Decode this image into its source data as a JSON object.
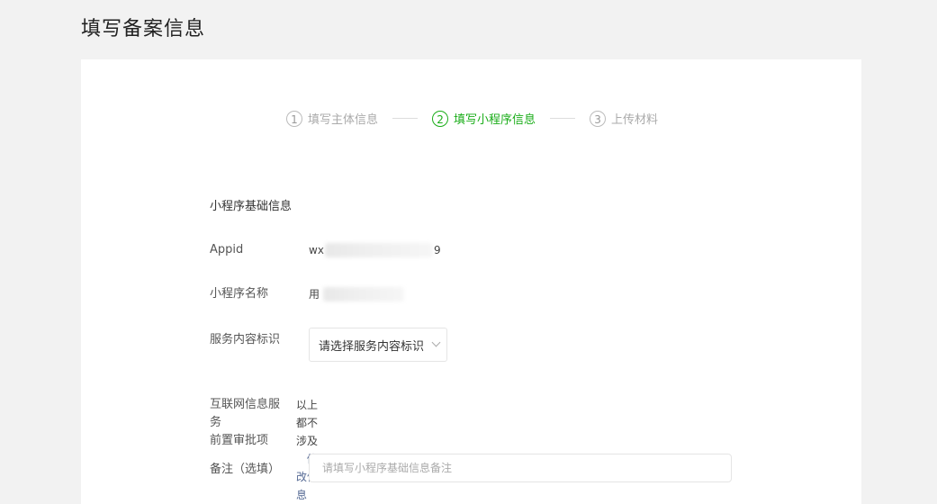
{
  "page": {
    "title": "填写备案信息"
  },
  "steps": [
    {
      "num": "1",
      "label": "填写主体信息"
    },
    {
      "num": "2",
      "label": "填写小程序信息"
    },
    {
      "num": "3",
      "label": "上传材料"
    }
  ],
  "form": {
    "section_title": "小程序基础信息",
    "appid": {
      "label": "Appid",
      "value_start": "wx",
      "value_end": "9"
    },
    "name": {
      "label": "小程序名称",
      "value_start": "用"
    },
    "service": {
      "label": "服务内容标识",
      "placeholder": "请选择服务内容标识"
    },
    "approval": {
      "label_line1": "互联网信息服务",
      "label_line2": "前置审批项",
      "value": "以上都不涉及",
      "link": "修改信息"
    },
    "remark": {
      "label": "备注（选填）",
      "placeholder": "请填写小程序基础信息备注"
    }
  },
  "colors": {
    "accent": "#1aad19",
    "link": "#576b95"
  }
}
